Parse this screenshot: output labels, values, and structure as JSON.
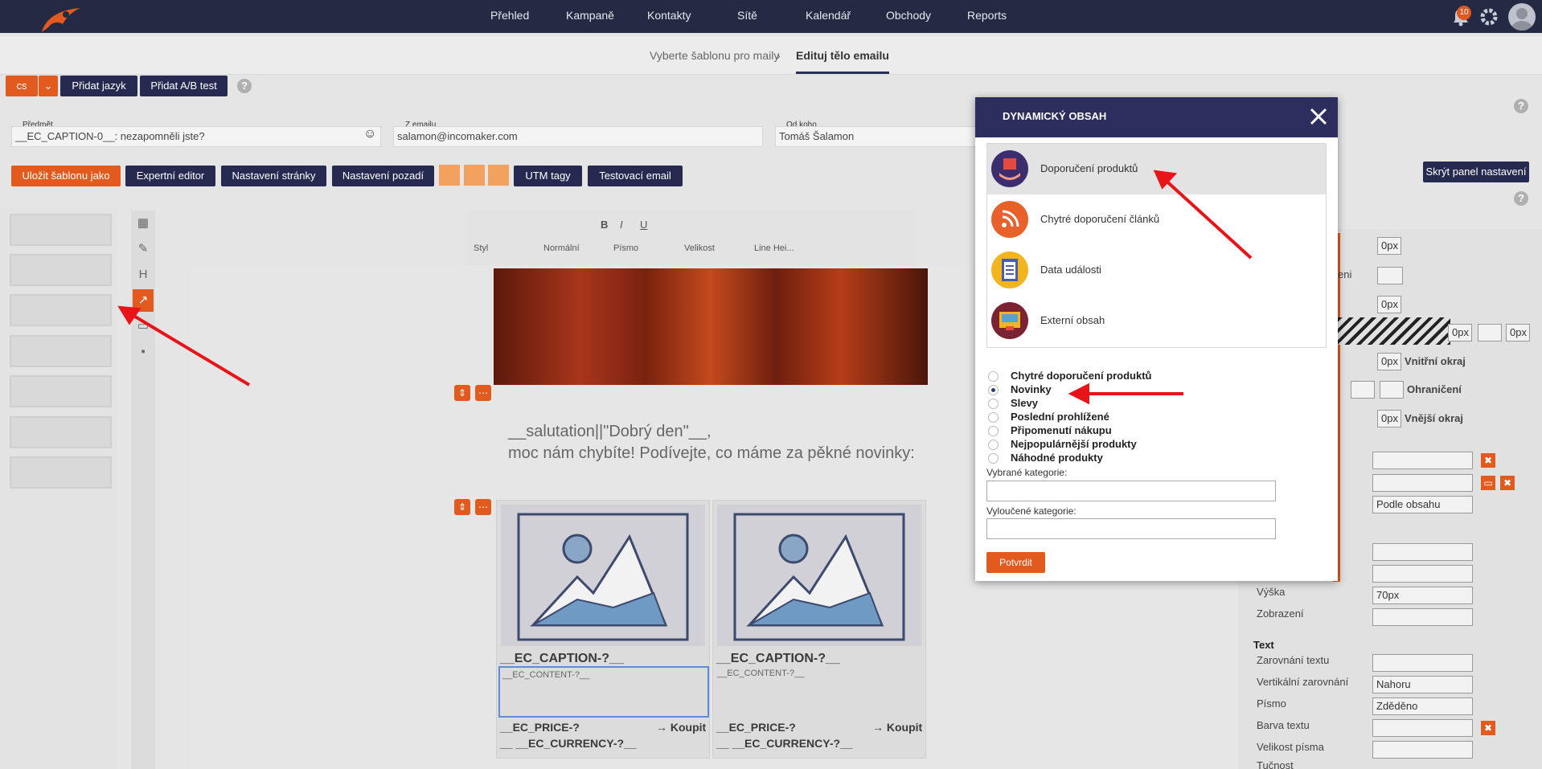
{
  "nav": {
    "items": [
      "Přehled",
      "Kampaně",
      "Kontakty",
      "Sítě",
      "Kalendář",
      "Obchody",
      "Reports"
    ],
    "notifications": "10"
  },
  "breadcrumb": {
    "step1": "Vyberte šablonu pro maily",
    "step2": "Edituj tělo emailu"
  },
  "lang": {
    "value": "cs",
    "add_language": "Přidat jazyk",
    "add_ab": "Přidat A/B test"
  },
  "fields": {
    "subject_label": "Předmět",
    "subject_value": "__EC_CAPTION-0__: nezapomněli jste?",
    "from_email_label": "Z emailu",
    "from_email_value": "salamon@incomaker.com",
    "from_name_label": "Od koho",
    "from_name_value": "Tomáš Šalamon"
  },
  "toolbar": {
    "save_template": "Uložit šablonu jako",
    "expert_editor": "Expertní editor",
    "page_settings": "Nastavení stránky",
    "background_settings": "Nastavení pozadí",
    "utm_tags": "UTM tagy",
    "test_email": "Testovací email",
    "hide_panel": "Skrýt panel nastavení"
  },
  "editor_toolbar": {
    "style": "Styl",
    "format": "Normální",
    "font": "Písmo",
    "size": "Velikost",
    "line_height": "Line Hei..."
  },
  "content": {
    "salutation": "__salutation||\"Dobrý den\"__,",
    "body": "moc nám chybíte! Podívejte, co máme za pěkné novinky:",
    "products": [
      {
        "caption": "__EC_CAPTION-?__",
        "content": "__EC_CONTENT-?__",
        "price": "__EC_PRICE-?",
        "currency": "__ __EC_CURRENCY-?__",
        "buy": "→ Koupit"
      },
      {
        "caption": "__EC_CAPTION-?__",
        "content": "__EC_CONTENT-?__",
        "price": "__EC_PRICE-?",
        "currency": "__ __EC_CURRENCY-?__",
        "buy": "→ Koupit"
      }
    ]
  },
  "right_panel": {
    "px_values": [
      "0px",
      "0px",
      "0px",
      "0px",
      "0px",
      "0px",
      "0px"
    ],
    "partial_label": "eni",
    "inner_border": "Vnitřní okraj",
    "border": "Ohraničení",
    "outer_border": "Vnější okraj",
    "by_content": "Podle obsahu",
    "height_label": "Výška",
    "height_value": "70px",
    "display_label": "Zobrazení",
    "text_section": "Text",
    "text_align": "Zarovnání textu",
    "vertical_align": "Vertikální zarovnání",
    "vertical_value": "Nahoru",
    "font_label": "Písmo",
    "font_value": "Zděděno",
    "text_color": "Barva textu",
    "font_size": "Velikost písma",
    "bold": "Tučnost"
  },
  "modal": {
    "title": "DYNAMICKÝ OBSAH",
    "items": [
      {
        "label": "Doporučení produktů",
        "icon": "product-recommendation-icon",
        "color": "#3c2d6e"
      },
      {
        "label": "Chytré doporučení článků",
        "icon": "rss-icon",
        "color": "#e8602a"
      },
      {
        "label": "Data události",
        "icon": "clipboard-icon",
        "color": "#f2b51e"
      },
      {
        "label": "Externí obsah",
        "icon": "external-content-icon",
        "color": "#7b2233"
      }
    ],
    "options": [
      {
        "label": "Chytré doporučení produktů",
        "checked": false
      },
      {
        "label": "Novinky",
        "checked": true
      },
      {
        "label": "Slevy",
        "checked": false
      },
      {
        "label": "Poslední prohlížené",
        "checked": false
      },
      {
        "label": "Připomenutí nákupu",
        "checked": false
      },
      {
        "label": "Nejpopulárnější produkty",
        "checked": false
      },
      {
        "label": "Náhodné produkty",
        "checked": false
      }
    ],
    "selected_categories_label": "Vybrané kategorie:",
    "excluded_categories_label": "Vyloučené kategorie:",
    "confirm": "Potvrdit"
  }
}
